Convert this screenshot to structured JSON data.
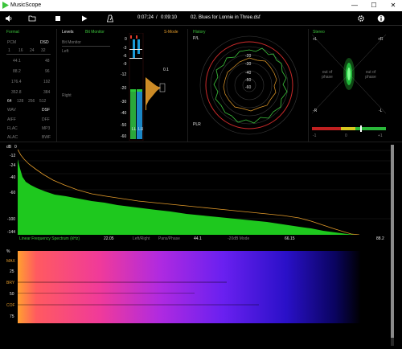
{
  "app": {
    "title": "MusicScope"
  },
  "window": {
    "minimize": "—",
    "maximize": "☐",
    "close": "✕"
  },
  "toolbar": {
    "time_elapsed": "0:07:24",
    "time_sep": "/",
    "time_total": "0:09:10",
    "track": "02. Blues for Lonnie in Three.dsf",
    "icons": [
      "volume-icon",
      "folder-icon",
      "stop-icon",
      "play-icon",
      "metronome-icon",
      "settings-icon",
      "info-icon"
    ]
  },
  "format": {
    "title": "Format",
    "pcm": "PCM",
    "dsd": "DSD",
    "dsd_rates": [
      "1",
      "16",
      "24",
      "32"
    ],
    "left_col": [
      "44.1",
      "88.2",
      "176.4",
      "352.8"
    ],
    "right_col": [
      "48",
      "96",
      "192",
      "384"
    ],
    "dsd_mult": [
      "64",
      "128",
      "256",
      "512"
    ],
    "types_left": [
      "WAV",
      "AIFF",
      "FLAC",
      "ALAC"
    ],
    "types_right": [
      "DSF",
      "DFF",
      "MP3",
      "BWF"
    ]
  },
  "levels": {
    "title": "Levels",
    "mode": "Bit Monitor",
    "sub": "Bit Monitor",
    "left": "Left",
    "right": "Right",
    "s_mode": "S-Mode",
    "scale": [
      "0",
      "-3",
      "-6",
      "-9",
      "-12",
      "-20",
      "-30",
      "-40",
      "-50",
      "-60"
    ],
    "ch_labels": [
      "LL",
      "LU"
    ],
    "peak_value": "0.1"
  },
  "history": {
    "title": "History",
    "pl": "P/L",
    "plr": "PLR",
    "rings": [
      "-20",
      "-30",
      "-40",
      "-50",
      "-60"
    ]
  },
  "stereo": {
    "title": "Stereo",
    "tl": "+L",
    "tr": "+R",
    "bl": "-R",
    "br": "-L",
    "oop": "out of phase",
    "corr": [
      "-1",
      "0",
      "+1"
    ]
  },
  "spectrum": {
    "db_unit": "dB",
    "db": [
      "0",
      "-12",
      "-24",
      "-40",
      "-60",
      "-100",
      "-144"
    ],
    "title": "Linear Frequency Spectrum (kHz)",
    "freqs": [
      "22.05",
      "44.1",
      "66.15",
      "88.2"
    ],
    "modes": [
      "Left/Right",
      "Pans/Phase",
      "-20dB Mode"
    ]
  },
  "spectrogram": {
    "pct": "%",
    "labels": [
      "MAX",
      "25",
      "BRY",
      "50",
      "COF",
      "75"
    ]
  },
  "colors": {
    "green": "#3cc43c",
    "orange": "#e29a2a",
    "accent_blue": "#1a9ad6",
    "red": "#e23a2a"
  }
}
